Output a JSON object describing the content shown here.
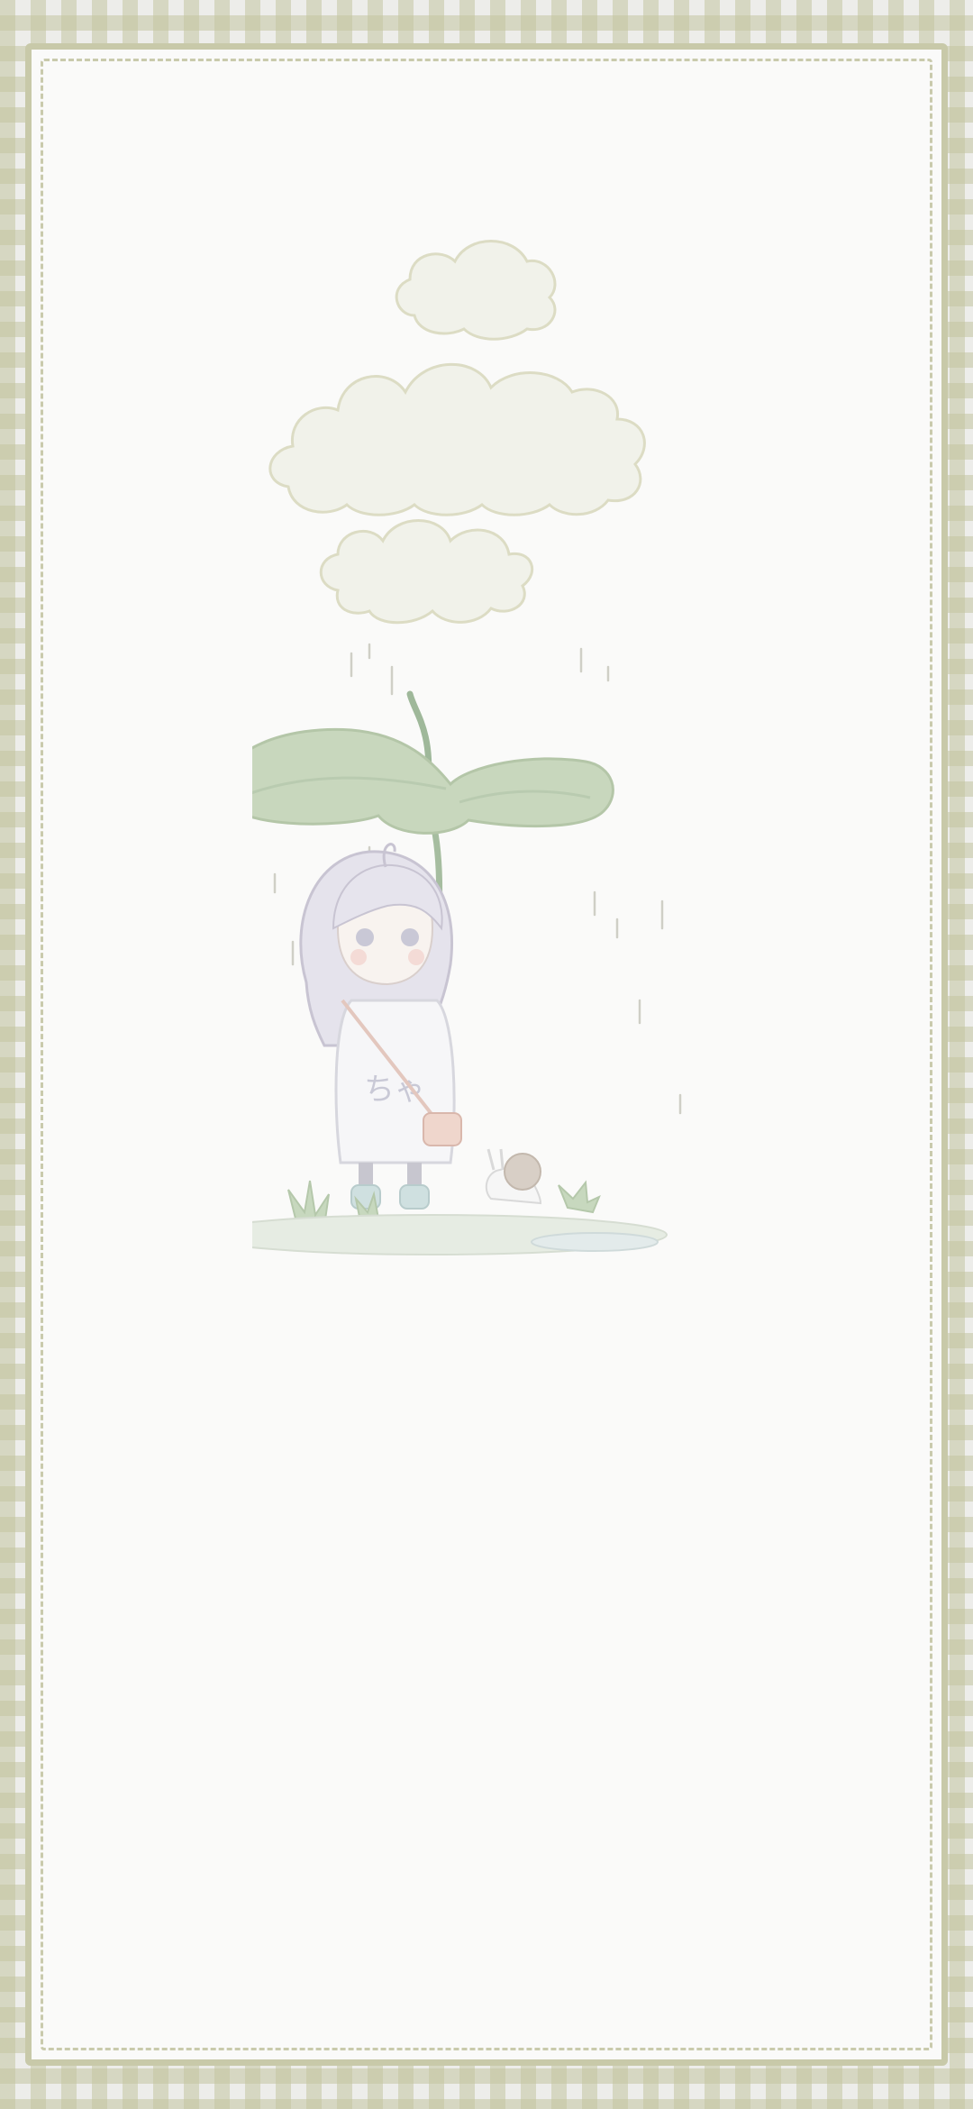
{
  "wallpaper": {
    "border_pattern": "gingham",
    "border_color": "#c8c9a9",
    "panel_color": "#fafaf9",
    "stitch_color": "#c9caac"
  },
  "illustration": {
    "subject": "girl-under-leaf-umbrella",
    "icons": [
      "cloud-icon",
      "rain-icon",
      "leaf-umbrella-icon",
      "girl-icon",
      "snail-icon",
      "grass-icon",
      "puddle-icon"
    ],
    "shirt_lettering": "ちゃ"
  }
}
